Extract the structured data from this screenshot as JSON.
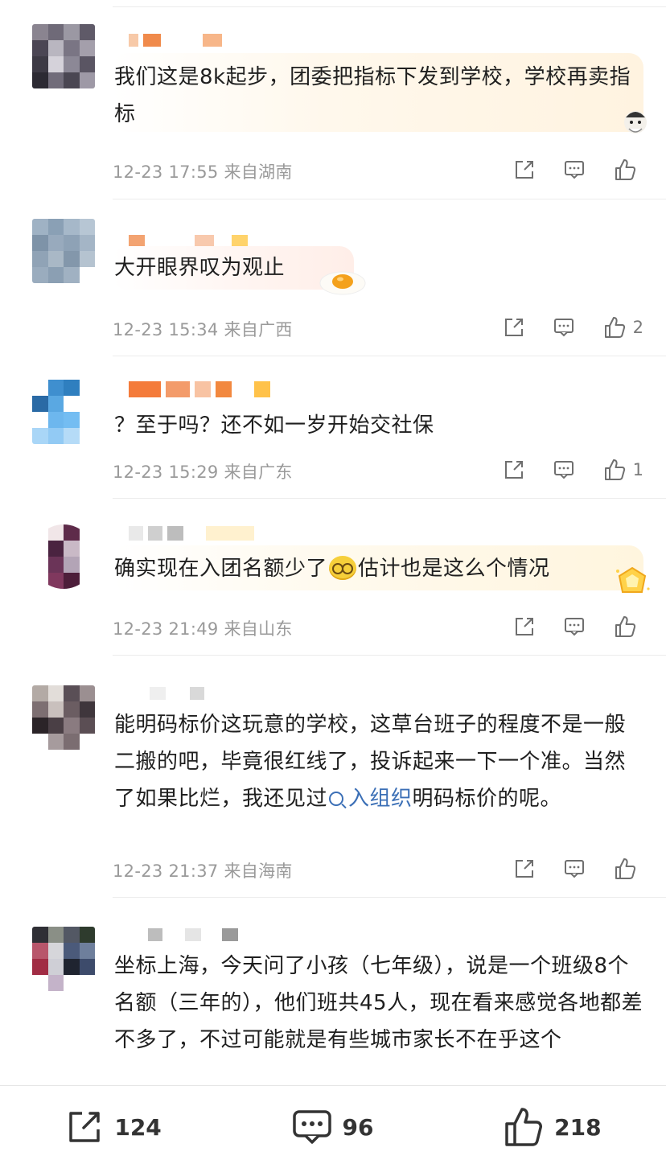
{
  "comments": [
    {
      "text": "我们这是8k起步，团委把指标下发到学校，学校再卖指标",
      "time": "12-23 17:55",
      "location": "来自湖南",
      "like_count": ""
    },
    {
      "text": "大开眼界叹为观止",
      "time": "12-23 15:34",
      "location": "来自广西",
      "like_count": "2"
    },
    {
      "text": "？至于吗？还不如一岁开始交社保",
      "time": "12-23 15:29",
      "location": "来自广东",
      "like_count": "1"
    },
    {
      "text_before": "确实现在入团名额少了",
      "text_after": "估计也是这么个情况",
      "emoji": "glasses-face-emoji",
      "time": "12-23 21:49",
      "location": "来自山东",
      "like_count": ""
    },
    {
      "text_before": "能明码标价这玩意的学校，这草台班子的程度不是一般二搬的吧，毕竟很红线了，投诉起来一下一个准。当然了如果比烂，我还见过",
      "link_text": "入组织",
      "text_after": "明码标价的呢。",
      "time": "12-23 21:37",
      "location": "来自海南",
      "like_count": ""
    },
    {
      "text": "坐标上海，今天问了小孩（七年级），说是一个班级8个名额（三年的），他们班共45人，现在看来感觉各地都差不多了，不过可能就是有些城市家长不在乎这个"
    }
  ],
  "bottom_bar": {
    "repost_count": "124",
    "comment_count": "96",
    "like_count": "218"
  },
  "icons": {
    "share": "share-icon",
    "reply": "comment-icon",
    "like": "thumbs-up-icon",
    "search": "search-icon"
  },
  "colors": {
    "link": "#3b6fb6",
    "meta": "#9a9a9a",
    "bubble_warm": "#fff6e8"
  }
}
